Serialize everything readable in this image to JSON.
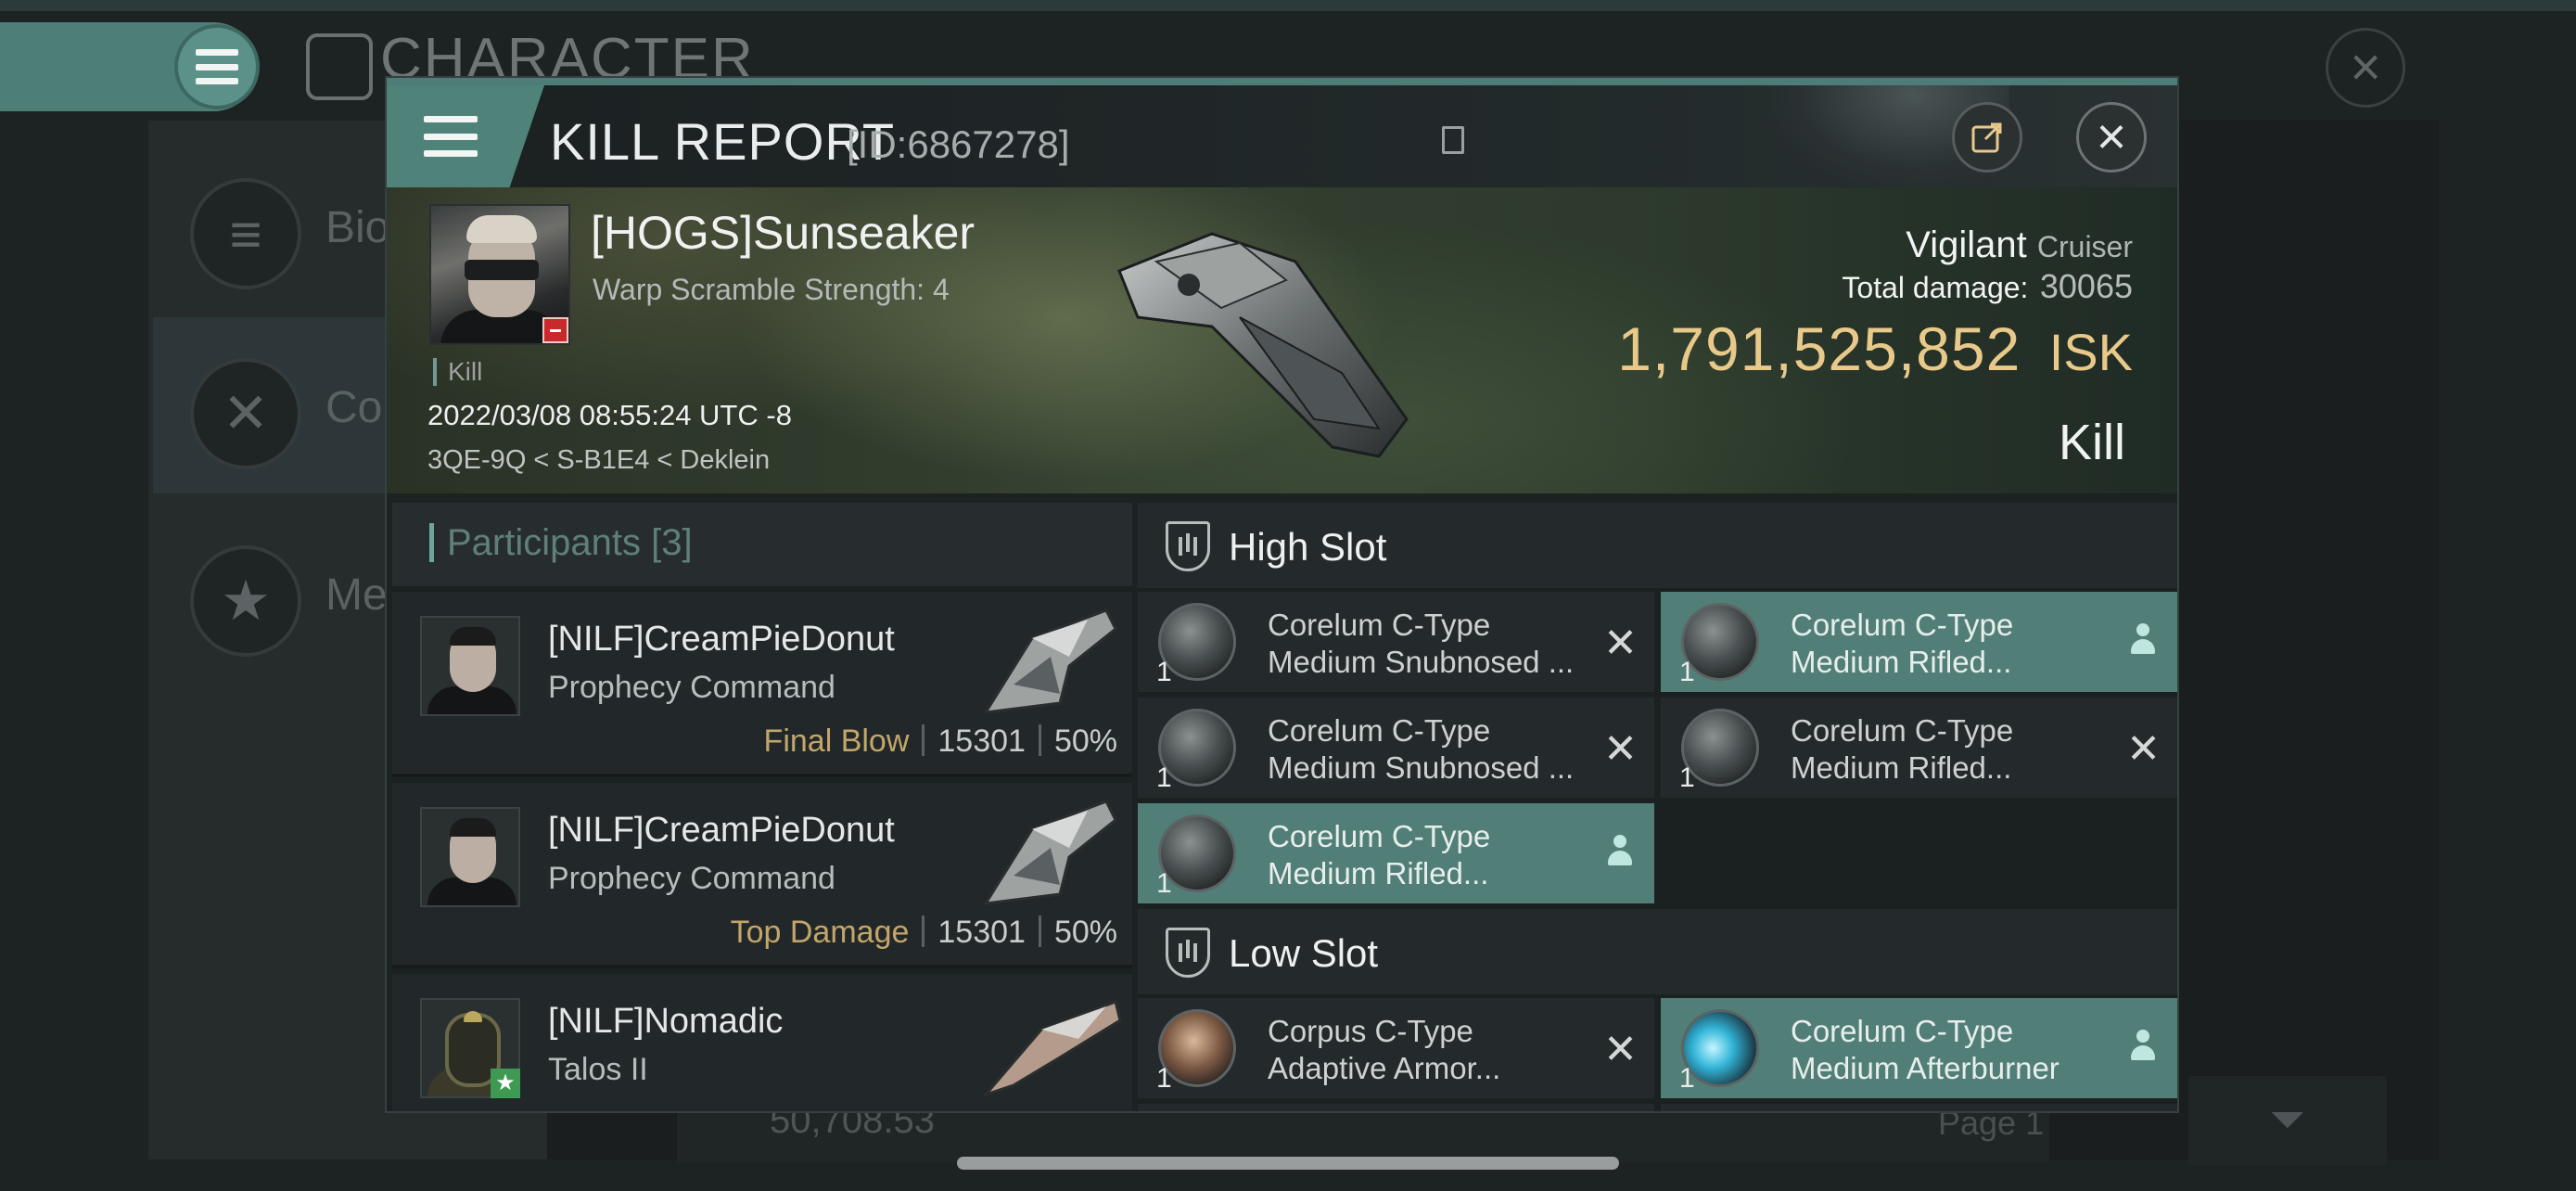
{
  "background": {
    "screen_title": "CHARACTER",
    "side_items": [
      {
        "label": "Bio",
        "icon": "list-icon"
      },
      {
        "label": "Cor",
        "icon": "crossed-swords-icon"
      },
      {
        "label": "Me",
        "icon": "star-medal-icon"
      }
    ],
    "bottom_value": "50,708.53",
    "page_label": "Page 1"
  },
  "header": {
    "title": "KILL REPORT",
    "id_tag": "[ID:6867278]"
  },
  "victim": {
    "name": "[HOGS]Sunseaker",
    "info": "Warp Scramble Strength: 4",
    "tag": "Kill",
    "datetime": "2022/03/08 08:55:24 UTC -8",
    "location": "3QE-9Q < S-B1E4 < Deklein",
    "ship_name": "Vigilant",
    "ship_class": "Cruiser",
    "total_damage_label": "Total damage:",
    "total_damage": "30065",
    "isk_value": "1,791,525,852",
    "isk_currency": "ISK",
    "result": "Kill"
  },
  "participants": {
    "title": "Participants [3]",
    "rows": [
      {
        "name": "[NILF]CreamPieDonut",
        "ship": "Prophecy Command",
        "tag": "Final Blow",
        "damage": "15301",
        "percent": "50%"
      },
      {
        "name": "[NILF]CreamPieDonut",
        "ship": "Prophecy Command",
        "tag": "Top Damage",
        "damage": "15301",
        "percent": "50%"
      },
      {
        "name": "[NILF]Nomadic",
        "ship": "Talos II",
        "tag": "",
        "damage": "",
        "percent": ""
      }
    ]
  },
  "modules": {
    "high_slot_label": "High Slot",
    "low_slot_label": "Low Slot",
    "high": [
      {
        "name": "Corelum C-Type Medium Snubnosed ...",
        "qty": "1",
        "state": "destroyed"
      },
      {
        "name": "Corelum C-Type Medium Rifled...",
        "qty": "1",
        "state": "dropped"
      },
      {
        "name": "Corelum C-Type Medium Snubnosed ...",
        "qty": "1",
        "state": "destroyed"
      },
      {
        "name": "Corelum C-Type Medium Rifled...",
        "qty": "1",
        "state": "destroyed"
      },
      {
        "name": "Corelum C-Type Medium Rifled...",
        "qty": "1",
        "state": "dropped"
      }
    ],
    "low": [
      {
        "name": "Corpus C-Type Adaptive Armor...",
        "qty": "1",
        "state": "destroyed"
      },
      {
        "name": "Corelum C-Type Medium Afterburner",
        "qty": "1",
        "state": "dropped"
      }
    ]
  },
  "colors": {
    "accent": "#517f78",
    "isk": "#e8c98a",
    "tag_gold": "#c2a66a"
  }
}
